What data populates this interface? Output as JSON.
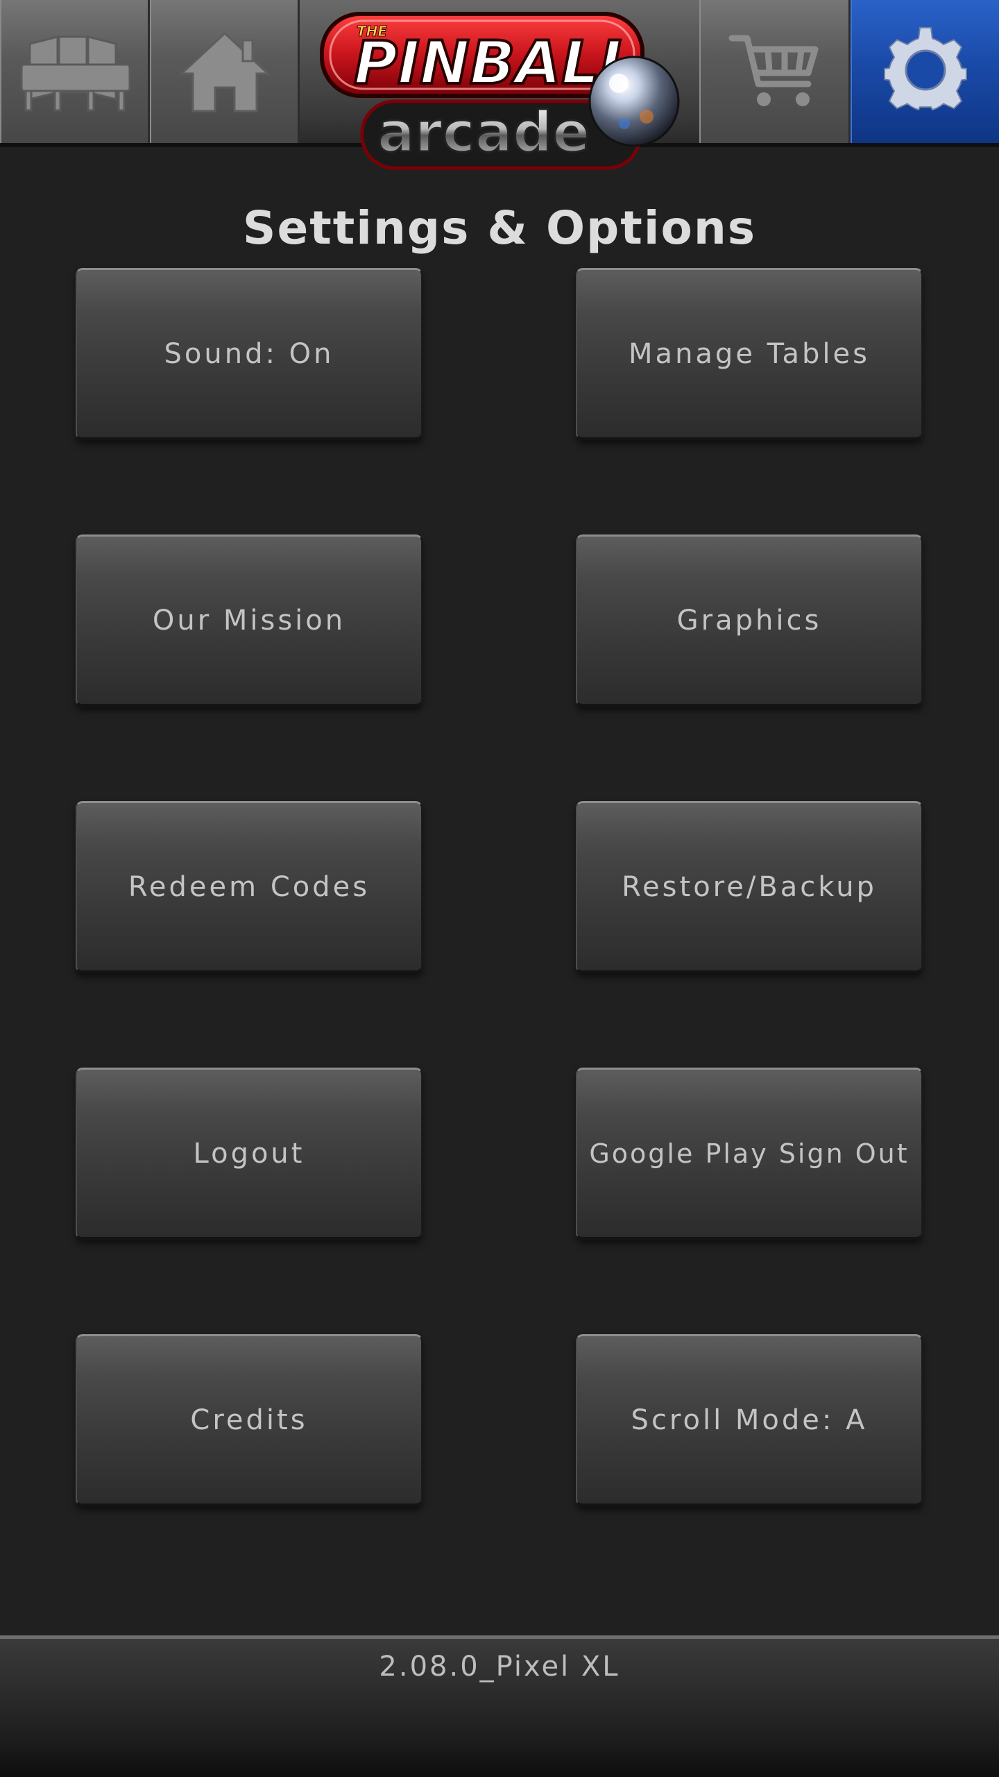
{
  "header": {
    "tabs": [
      {
        "name": "tables",
        "icon": "pinball-tables-icon",
        "active": false
      },
      {
        "name": "home",
        "icon": "home-icon",
        "active": false
      },
      {
        "name": "store",
        "icon": "shopping-cart-icon",
        "active": false
      },
      {
        "name": "settings",
        "icon": "gear-icon",
        "active": true
      }
    ],
    "logo": {
      "top_text": "THE",
      "main_text": "PINBALL",
      "sub_text": "arcade"
    }
  },
  "page": {
    "title": "Settings & Options"
  },
  "options": {
    "sound": "Sound: On",
    "manage_tables": "Manage Tables",
    "our_mission": "Our Mission",
    "graphics": "Graphics",
    "redeem_codes": "Redeem Codes",
    "restore_backup": "Restore/Backup",
    "logout": "Logout",
    "google_play_sign_out": "Google Play Sign Out",
    "credits": "Credits",
    "scroll_mode": "Scroll Mode: A"
  },
  "footer": {
    "version": "2.08.0_Pixel XL"
  },
  "colors": {
    "background": "#202020",
    "active_tab": "#1a4aa8",
    "button_text": "#c4c4c4",
    "logo_red": "#c8141c"
  }
}
